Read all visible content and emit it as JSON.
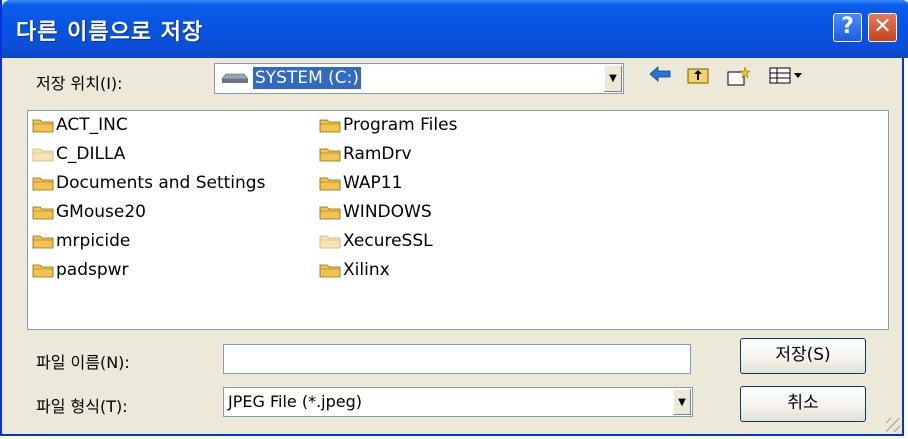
{
  "window": {
    "title": "다른 이름으로 저장",
    "help_glyph": "?",
    "close_glyph": "✕"
  },
  "location": {
    "label": "저장 위치(I):",
    "value": "SYSTEM (C:)",
    "icon": "drive-icon"
  },
  "toolbar": {
    "back_icon": "back-arrow-icon",
    "up_icon": "up-folder-icon",
    "new_folder_icon": "new-folder-icon",
    "view_menu_icon": "view-menu-icon"
  },
  "files": {
    "column1": [
      {
        "name": "ACT_INC",
        "icon": "folder-icon"
      },
      {
        "name": "C_DILLA",
        "icon": "folder-icon-faded"
      },
      {
        "name": "Documents and Settings",
        "icon": "folder-icon"
      },
      {
        "name": "GMouse20",
        "icon": "folder-icon"
      },
      {
        "name": "mrpicide",
        "icon": "folder-icon"
      },
      {
        "name": "padspwr",
        "icon": "folder-icon"
      }
    ],
    "column2": [
      {
        "name": "Program Files",
        "icon": "folder-icon"
      },
      {
        "name": "RamDrv",
        "icon": "folder-icon"
      },
      {
        "name": "WAP11",
        "icon": "folder-icon"
      },
      {
        "name": "WINDOWS",
        "icon": "folder-icon"
      },
      {
        "name": "XecureSSL",
        "icon": "folder-icon-faded"
      },
      {
        "name": "Xilinx",
        "icon": "folder-icon"
      }
    ]
  },
  "filename": {
    "label": "파일 이름(N):",
    "value": ""
  },
  "filetype": {
    "label": "파일 형식(T):",
    "value": "JPEG File (*.jpeg)"
  },
  "buttons": {
    "save": "저장(S)",
    "cancel": "취소"
  },
  "colors": {
    "titlebar": "#0854e3",
    "selection": "#316ac5",
    "folder": "#f3c34d"
  }
}
